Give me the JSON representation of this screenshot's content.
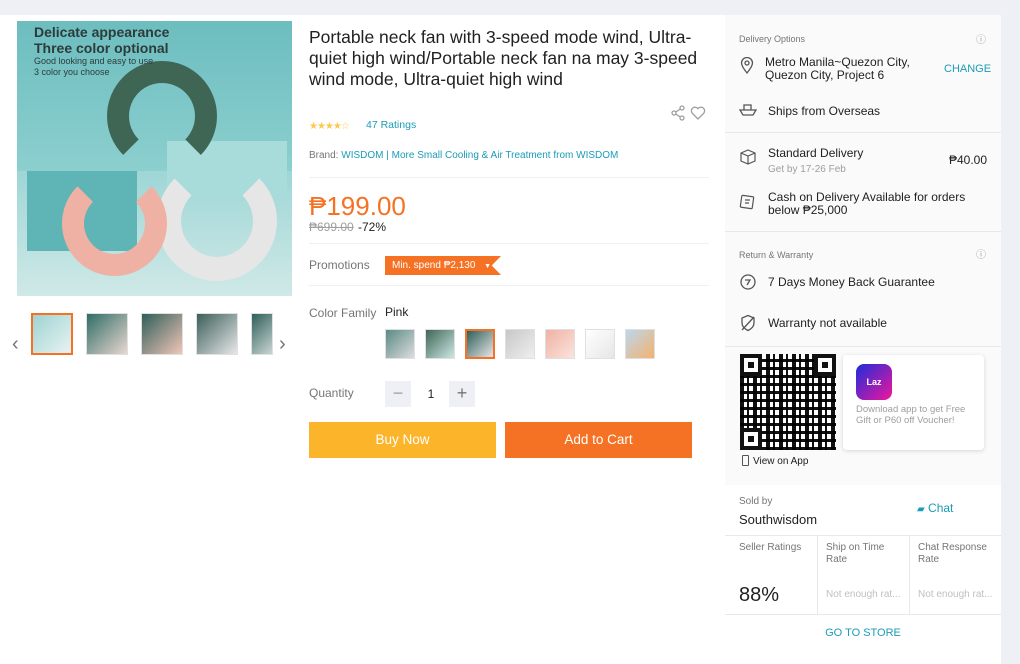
{
  "product": {
    "image_text_line1": "Delicate appearance",
    "image_text_line2": "Three color optional",
    "image_text_line3": "Good looking and easy to use",
    "image_text_line4": "3 color you choose",
    "title": "Portable neck fan with 3-speed mode wind, Ultra-quiet high wind/Portable neck fan na may 3-speed wind mode, Ultra-quiet high wind",
    "stars_glyph": "★★★★☆",
    "ratings": "47 Ratings",
    "brand_label": "Brand:",
    "brand_name": "WISDOM",
    "brand_more": "| More Small Cooling & Air Treatment from WISDOM",
    "price": "₱199.00",
    "old_price": "₱699.00",
    "discount": "-72%",
    "promotions_label": "Promotions",
    "promo_tag": "Min. spend ₱2,130",
    "color_label": "Color Family",
    "color_value": "Pink",
    "quantity_label": "Quantity",
    "quantity": "1",
    "minus": "−",
    "plus": "+",
    "buy_now": "Buy Now",
    "add_to_cart": "Add to Cart"
  },
  "delivery": {
    "heading": "Delivery Options",
    "address": "Metro Manila~Quezon City, Quezon City, Project 6",
    "change": "CHANGE",
    "ships_from": "Ships from Overseas",
    "standard": "Standard Delivery",
    "standard_eta": "Get by 17-26 Feb",
    "standard_price": "₱40.00",
    "cod": "Cash on Delivery Available for orders below ₱25,000"
  },
  "warranty": {
    "heading": "Return & Warranty",
    "return": "7 Days Money Back Guarantee",
    "warranty": "Warranty not available"
  },
  "app": {
    "logo": "Laz",
    "promo": "Download app to get Free Gift or P60 off Voucher!",
    "view_on_app": "View on App"
  },
  "seller": {
    "sold_by": "Sold by",
    "name": "Southwisdom",
    "chat": "Chat",
    "seller_ratings_label": "Seller Ratings",
    "seller_ratings_value": "88%",
    "ship_on_time_label": "Ship on Time Rate",
    "ship_on_time_value": "Not enough rat...",
    "chat_response_label": "Chat Response Rate",
    "chat_response_value": "Not enough rat...",
    "go_to_store": "GO TO STORE"
  },
  "colors": {
    "accent": "#f57224",
    "buy": "#fcb42a",
    "link": "#1a9cb7"
  }
}
